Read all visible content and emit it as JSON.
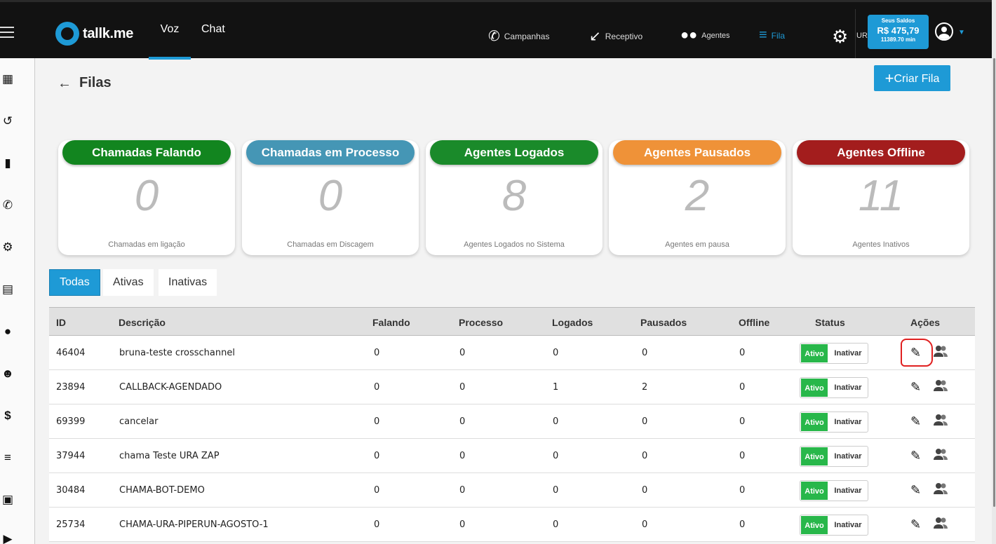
{
  "brand": {
    "name": "tallk.me",
    "accent": "#1e9ad6"
  },
  "top_tabs": [
    {
      "label": "Voz",
      "active": true
    },
    {
      "label": "Chat",
      "active": false
    }
  ],
  "nav": [
    {
      "label": "Campanhas",
      "icon": "phone-ring-icon"
    },
    {
      "label": "Receptivo",
      "icon": "incoming-call-icon"
    },
    {
      "label": "Agentes",
      "icon": "agents-icon"
    },
    {
      "label": "Fila",
      "icon": "queue-list-icon",
      "active": true
    }
  ],
  "ura_label": "UR",
  "balance": {
    "label": "Seus Saldos",
    "amount": "R$ 475,79",
    "minutes": "11389.70 min"
  },
  "page": {
    "title": "Filas",
    "create_button": "Criar Fila"
  },
  "cards": [
    {
      "title": "Chamadas Falando",
      "value": "0",
      "subtitle": "Chamadas em ligação",
      "color": "#12851f"
    },
    {
      "title": "Chamadas em Processo",
      "value": "0",
      "subtitle": "Chamadas em Discagem",
      "color": "#4596b5"
    },
    {
      "title": "Agentes Logados",
      "value": "8",
      "subtitle": "Agentes Logados no Sistema",
      "color": "#1a8a2a"
    },
    {
      "title": "Agentes Pausados",
      "value": "2",
      "subtitle": "Agentes em pausa",
      "color": "#ef9238"
    },
    {
      "title": "Agentes Offline",
      "value": "11",
      "subtitle": "Agentes Inativos",
      "color": "#a31d1d"
    }
  ],
  "filters": [
    {
      "label": "Todas",
      "active": true
    },
    {
      "label": "Ativas",
      "active": false
    },
    {
      "label": "Inativas",
      "active": false
    }
  ],
  "table": {
    "headers": [
      "ID",
      "Descrição",
      "Falando",
      "Processo",
      "Logados",
      "Pausados",
      "Offline",
      "Status",
      "Ações"
    ],
    "status_on": "Ativo",
    "status_off": "Inativar",
    "rows": [
      {
        "id": "46404",
        "desc": "bruna-teste crosschannel",
        "falando": "0",
        "processo": "0",
        "logados": "0",
        "pausados": "0",
        "offline": "0"
      },
      {
        "id": "23894",
        "desc": "CALLBACK-AGENDADO",
        "falando": "0",
        "processo": "0",
        "logados": "1",
        "pausados": "2",
        "offline": "0"
      },
      {
        "id": "69399",
        "desc": "cancelar",
        "falando": "0",
        "processo": "0",
        "logados": "0",
        "pausados": "0",
        "offline": "0"
      },
      {
        "id": "37944",
        "desc": "chama Teste URA ZAP",
        "falando": "0",
        "processo": "0",
        "logados": "0",
        "pausados": "0",
        "offline": "0"
      },
      {
        "id": "30484",
        "desc": "CHAMA-BOT-DEMO",
        "falando": "0",
        "processo": "0",
        "logados": "0",
        "pausados": "0",
        "offline": "0"
      },
      {
        "id": "25734",
        "desc": "CHAMA-URA-PIPERUN-AGOSTO-1",
        "falando": "0",
        "processo": "0",
        "logados": "0",
        "pausados": "0",
        "offline": "0"
      }
    ]
  }
}
